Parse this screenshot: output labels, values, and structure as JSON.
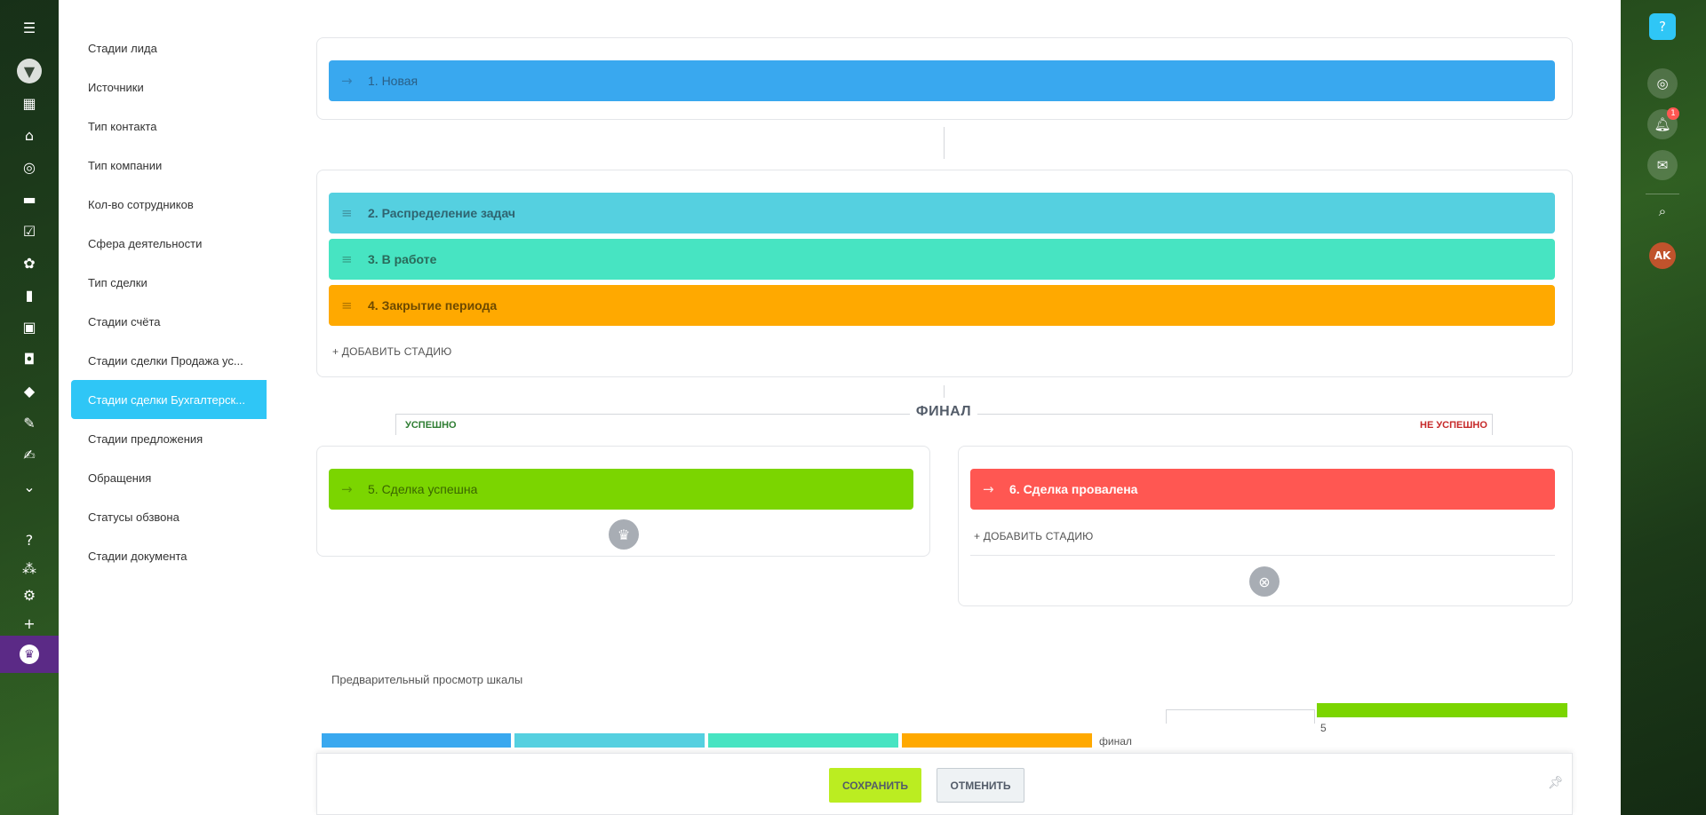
{
  "colors": {
    "new": "#39a8ef",
    "distribution": "#55d0e0",
    "in_work": "#47e4c2",
    "closing": "#ffa900",
    "success": "#7bd500",
    "fail": "#ff5752",
    "active_menu": "#2fc6f6",
    "save_button": "#bbed21"
  },
  "left_rail": {
    "icons": [
      "menu-icon",
      "funnel-icon",
      "calendar-icon",
      "bank-icon",
      "target-icon",
      "cart-icon",
      "checkbox-icon",
      "sites-icon",
      "analytics-icon",
      "contact-card-icon",
      "robot-icon",
      "box-icon",
      "edit-doc-icon",
      "signature-icon",
      "chevron-circle-icon",
      "help-icon",
      "structure-icon",
      "settings-icon",
      "plus-icon",
      "crown-icon"
    ]
  },
  "right_rail": {
    "notifications_count": "1",
    "avatar_initials": "AK",
    "icons": [
      "help-icon",
      "copilot-icon",
      "bell-icon",
      "chat-icon",
      "search-icon"
    ]
  },
  "side_menu": {
    "items": [
      "Стадии лида",
      "Источники",
      "Тип контакта",
      "Тип компании",
      "Кол-во сотрудников",
      "Сфера деятельности",
      "Тип сделки",
      "Стадии счёта",
      "Стадии сделки Продажа ус...",
      "Стадии сделки Бухгалтерск...",
      "Стадии предложения",
      "Обращения",
      "Статусы обзвона",
      "Стадии документа"
    ],
    "active_index": 9
  },
  "stages": {
    "first": "1. Новая",
    "middle": [
      "2. Распределение задач",
      "3. В работе",
      "4. Закрытие периода"
    ],
    "add_stage": "+ ДОБАВИТЬ СТАДИЮ"
  },
  "final": {
    "title": "ФИНАЛ",
    "success_label": "УСПЕШНО",
    "fail_label": "НЕ УСПЕШНО",
    "success_stage": "5. Сделка успешна",
    "fail_stage": "6. Сделка провалена",
    "add_stage": "+ ДОБАВИТЬ СТАДИЮ"
  },
  "preview": {
    "label": "Предварительный просмотр шкалы",
    "final_label": "финал",
    "success_number": "5"
  },
  "footer": {
    "save": "СОХРАНИТЬ",
    "cancel": "ОТМЕНИТЬ"
  }
}
